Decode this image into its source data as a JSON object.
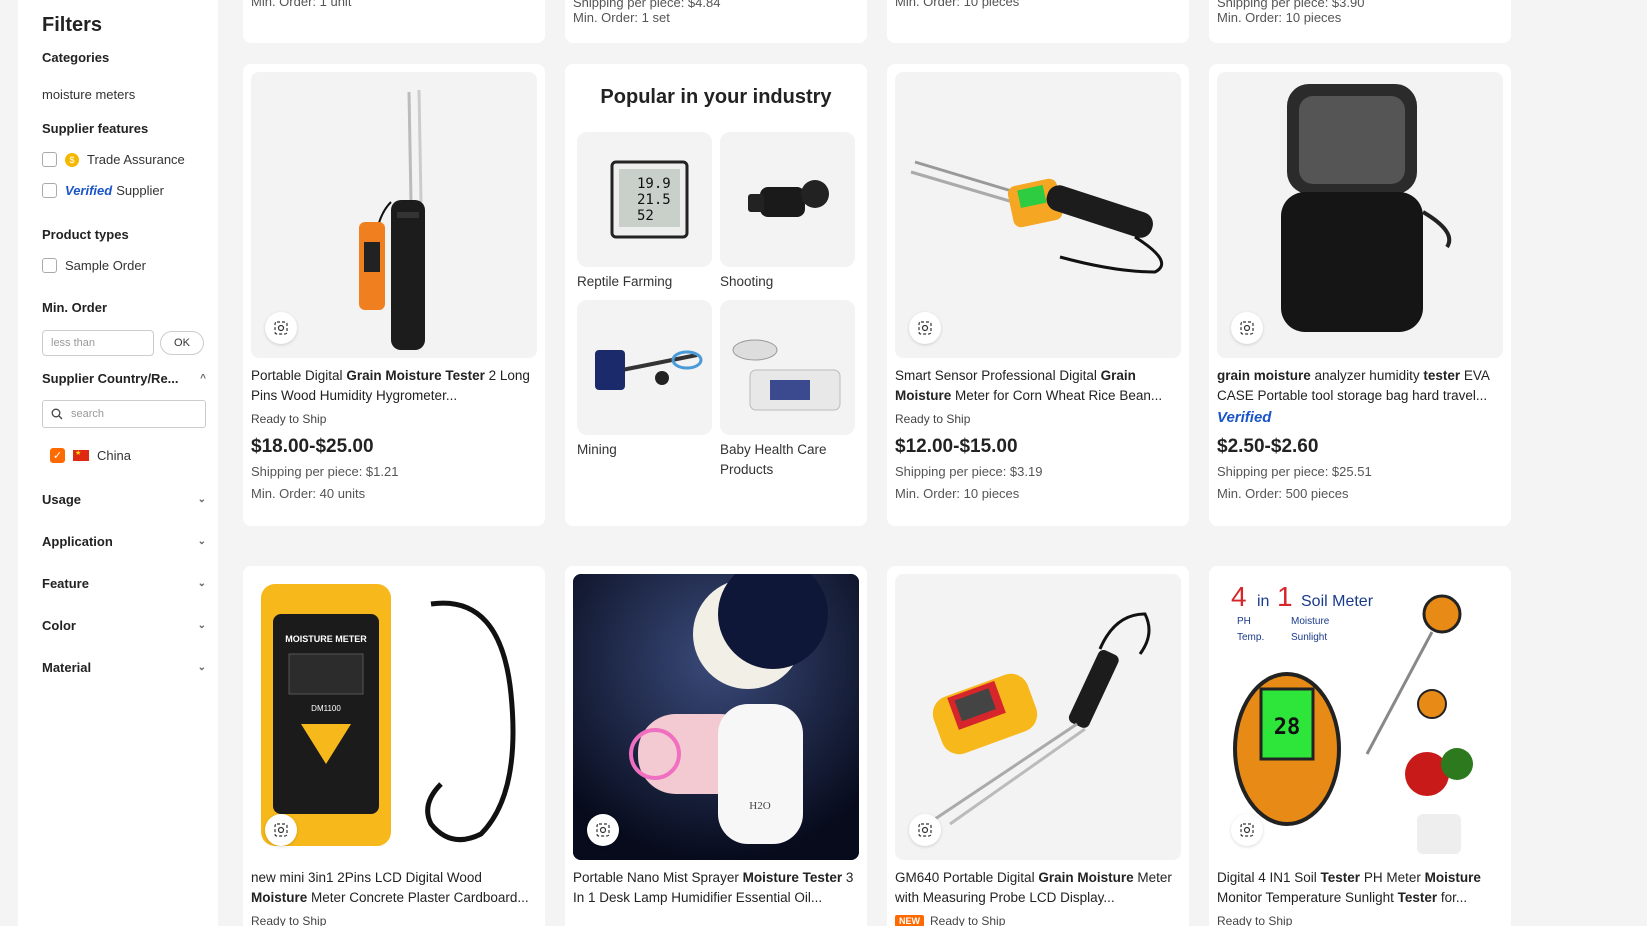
{
  "sidebar": {
    "title": "Filters",
    "categories_title": "Categories",
    "category": "moisture meters",
    "supplier_features_title": "Supplier features",
    "trade_assurance": "Trade Assurance",
    "verified_word": "Verified",
    "supplier_word": "Supplier",
    "product_types_title": "Product types",
    "sample_order": "Sample Order",
    "min_order_title": "Min. Order",
    "min_order_placeholder": "less than",
    "ok_label": "OK",
    "country_title": "Supplier Country/Re...",
    "search_placeholder": "search",
    "country": "China",
    "collapsed_sections": [
      "Usage",
      "Application",
      "Feature",
      "Color",
      "Material"
    ]
  },
  "top_partial": [
    {
      "moq": "Min. Order: 1 unit"
    },
    {
      "ship": "Shipping per piece: $4.84",
      "moq": "Min. Order: 1 set"
    },
    {
      "moq": "Min. Order: 10 pieces"
    },
    {
      "ship": "Shipping per piece: $3.90",
      "moq": "Min. Order: 10 pieces"
    }
  ],
  "popular": {
    "title": "Popular in your industry",
    "items": [
      "Reptile Farming",
      "Shooting",
      "Mining",
      "Baby Health Care Products"
    ]
  },
  "products_row1": [
    {
      "t1": "Portable Digital ",
      "b1": "Grain Moisture Tester",
      "t2": " 2 Long Pins Wood Humidity Hygrometer...",
      "rts": "Ready to Ship",
      "price": "$18.00-$25.00",
      "ship": "Shipping per piece: $1.21",
      "moq": "Min. Order: 40 units"
    },
    {
      "t1": "Smart Sensor Professional Digital ",
      "b1": "Grain Moisture",
      "t2": " Meter for Corn Wheat Rice Bean...",
      "rts": "Ready to Ship",
      "price": "$12.00-$15.00",
      "ship": "Shipping per piece: $3.19",
      "moq": "Min. Order: 10 pieces"
    },
    {
      "b1": "grain moisture",
      "t1": " analyzer humidity ",
      "b2": "tester",
      "t2": " EVA CASE Portable tool storage bag hard travel...",
      "verified": "Verified",
      "price": "$2.50-$2.60",
      "ship": "Shipping per piece: $25.51",
      "moq": "Min. Order: 500 pieces"
    }
  ],
  "products_row2": [
    {
      "t1": "new mini 3in1 2Pins LCD Digital Wood ",
      "b1": "Moisture",
      "t2": " Meter Concrete Plaster Cardboard...",
      "rts": "Ready to Ship"
    },
    {
      "t1": "Portable Nano Mist Sprayer ",
      "b1": "Moisture Tester",
      "t2": " 3 In 1 Desk Lamp Humidifier Essential Oil..."
    },
    {
      "t1": "GM640 Portable Digital ",
      "b1": "Grain Moisture",
      "t2": " Meter with Measuring Probe LCD Display...",
      "new": "NEW",
      "rts": "Ready to Ship"
    },
    {
      "t1": "Digital 4 IN1 Soil ",
      "b1": "Tester",
      "t2": " PH Meter ",
      "b2": "Moisture",
      "t3": " Monitor Temperature Sunlight ",
      "b3": "Tester",
      "t4": " for...",
      "rts": "Ready to Ship"
    }
  ],
  "image_text": {
    "moisture_meter": "MOISTURE METER",
    "model": "DM1100",
    "h2o": "H2O",
    "soil_4": "4",
    "soil_in": "in",
    "soil_1": "1",
    "soil_meter": "Soil Meter",
    "ph": "PH",
    "moisture": "Moisture",
    "temp": "Temp.",
    "sunlight": "Sunlight",
    "reading": "28"
  },
  "colors": {
    "accent": "#ff6a00",
    "verified": "#1a55c8",
    "background": "#f4f4f4"
  }
}
